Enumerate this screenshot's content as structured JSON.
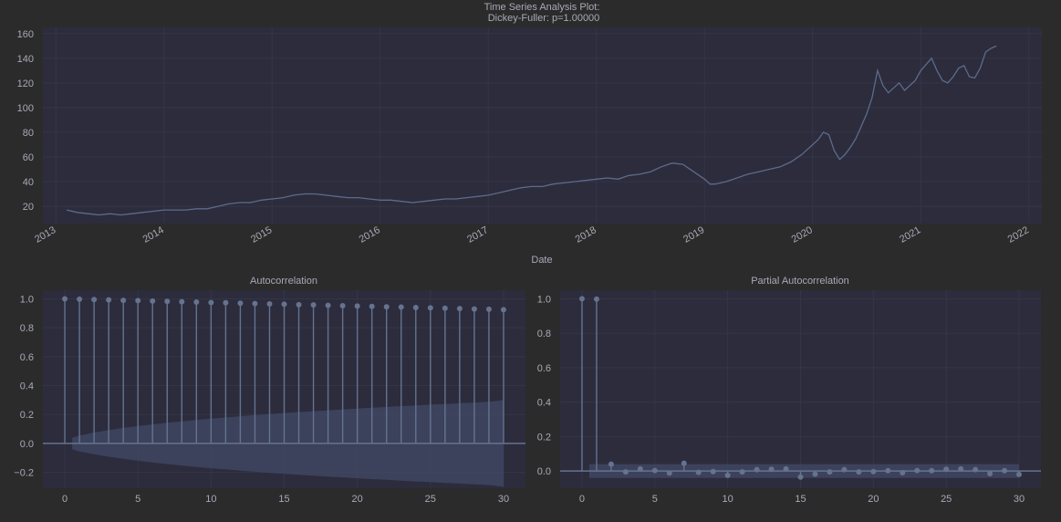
{
  "figure": {
    "title_line1": "Time Series Analysis Plot:",
    "title_line2": "Dickey-Fuller: p=1.00000"
  },
  "colors": {
    "figure_bg": "#2b2b2b",
    "axes_bg": "#2c2c3c",
    "line": "#5d6b8a",
    "stem": "#65738f",
    "conf_band": "#3f4762",
    "text": "#a9a9b8"
  },
  "chart_data": [
    {
      "type": "line",
      "title": "Time Series Analysis Plot:\nDickey-Fuller: p=1.00000",
      "xlabel": "Date",
      "ylabel": "",
      "x_ticks": [
        "2013",
        "2014",
        "2015",
        "2016",
        "2017",
        "2018",
        "2019",
        "2020",
        "2021",
        "2022"
      ],
      "y_ticks": [
        20,
        40,
        60,
        80,
        100,
        120,
        140,
        160
      ],
      "xlim": [
        2012.88,
        2022.12
      ],
      "ylim": [
        6,
        165
      ],
      "grid": true,
      "series": [
        {
          "x": [
            2013.1,
            2013.2,
            2013.3,
            2013.4,
            2013.5,
            2013.6,
            2013.7,
            2013.8,
            2013.9,
            2014.0,
            2014.1,
            2014.2,
            2014.3,
            2014.4,
            2014.5,
            2014.6,
            2014.7,
            2014.8,
            2014.9,
            2015.0,
            2015.1,
            2015.2,
            2015.3,
            2015.4,
            2015.5,
            2015.6,
            2015.7,
            2015.8,
            2015.9,
            2016.0,
            2016.1,
            2016.2,
            2016.3,
            2016.4,
            2016.5,
            2016.6,
            2016.7,
            2016.8,
            2016.9,
            2017.0,
            2017.1,
            2017.2,
            2017.3,
            2017.4,
            2017.5,
            2017.6,
            2017.7,
            2017.8,
            2017.9,
            2018.0,
            2018.1,
            2018.2,
            2018.3,
            2018.4,
            2018.5,
            2018.6,
            2018.7,
            2018.8,
            2018.9,
            2019.0,
            2019.05,
            2019.1,
            2019.2,
            2019.3,
            2019.4,
            2019.5,
            2019.6,
            2019.7,
            2019.8,
            2019.9,
            2020.0,
            2020.05,
            2020.1,
            2020.15,
            2020.2,
            2020.25,
            2020.3,
            2020.35,
            2020.4,
            2020.45,
            2020.5,
            2020.55,
            2020.6,
            2020.65,
            2020.7,
            2020.75,
            2020.8,
            2020.85,
            2020.9,
            2020.95,
            2021.0,
            2021.05,
            2021.1,
            2021.15,
            2021.2,
            2021.25,
            2021.3,
            2021.35,
            2021.4,
            2021.45,
            2021.5,
            2021.55,
            2021.6,
            2021.65,
            2021.7
          ],
          "y": [
            17,
            15,
            14,
            13,
            14,
            13,
            14,
            15,
            16,
            17,
            17,
            17,
            18,
            18,
            20,
            22,
            23,
            23,
            25,
            26,
            27,
            29,
            30,
            30,
            29,
            28,
            27,
            27,
            26,
            25,
            25,
            24,
            23,
            24,
            25,
            26,
            26,
            27,
            28,
            29,
            31,
            33,
            35,
            36,
            36,
            38,
            39,
            40,
            41,
            42,
            43,
            42,
            45,
            46,
            48,
            52,
            55,
            54,
            48,
            42,
            38,
            38,
            40,
            43,
            46,
            48,
            50,
            52,
            56,
            62,
            70,
            74,
            80,
            78,
            65,
            58,
            62,
            68,
            75,
            85,
            95,
            108,
            130,
            118,
            112,
            116,
            120,
            114,
            118,
            122,
            130,
            135,
            140,
            130,
            122,
            120,
            125,
            132,
            134,
            125,
            124,
            132,
            145,
            148,
            150
          ]
        }
      ]
    },
    {
      "type": "stem",
      "title": "Autocorrelation",
      "x": [
        0,
        1,
        2,
        3,
        4,
        5,
        6,
        7,
        8,
        9,
        10,
        11,
        12,
        13,
        14,
        15,
        16,
        17,
        18,
        19,
        20,
        21,
        22,
        23,
        24,
        25,
        26,
        27,
        28,
        29,
        30
      ],
      "values": [
        1.0,
        0.998,
        0.995,
        0.993,
        0.99,
        0.988,
        0.985,
        0.983,
        0.98,
        0.978,
        0.975,
        0.973,
        0.97,
        0.968,
        0.965,
        0.963,
        0.96,
        0.958,
        0.955,
        0.953,
        0.95,
        0.948,
        0.945,
        0.943,
        0.94,
        0.938,
        0.935,
        0.933,
        0.93,
        0.928,
        0.925
      ],
      "conf_band_upper": [
        0.04,
        0.055,
        0.075,
        0.092,
        0.107,
        0.12,
        0.132,
        0.143,
        0.153,
        0.163,
        0.172,
        0.18,
        0.188,
        0.196,
        0.203,
        0.21,
        0.217,
        0.223,
        0.229,
        0.235,
        0.241,
        0.247,
        0.252,
        0.258,
        0.263,
        0.268,
        0.273,
        0.278,
        0.283,
        0.288,
        0.3
      ],
      "x_ticks": [
        0,
        5,
        10,
        15,
        20,
        25,
        30
      ],
      "y_ticks": [
        "1.0",
        "0.8",
        "0.6",
        "0.4",
        "0.2",
        "0.0",
        "−0.2"
      ],
      "xlim": [
        -1.5,
        31.5
      ],
      "ylim": [
        -0.31,
        1.06
      ],
      "grid": true
    },
    {
      "type": "stem",
      "title": "Partial Autocorrelation",
      "x": [
        0,
        1,
        2,
        3,
        4,
        5,
        6,
        7,
        8,
        9,
        10,
        11,
        12,
        13,
        14,
        15,
        16,
        17,
        18,
        19,
        20,
        21,
        22,
        23,
        24,
        25,
        26,
        27,
        28,
        29,
        30
      ],
      "values": [
        1.0,
        0.998,
        0.04,
        -0.005,
        0.012,
        0.003,
        -0.012,
        0.045,
        -0.008,
        -0.003,
        -0.025,
        -0.005,
        0.008,
        0.01,
        0.012,
        -0.035,
        -0.018,
        -0.005,
        0.008,
        -0.005,
        -0.003,
        0.002,
        -0.01,
        0.003,
        0.002,
        0.01,
        0.012,
        0.008,
        -0.015,
        0.002,
        -0.02
      ],
      "conf_band_upper": [
        0.04,
        0.04,
        0.04,
        0.04,
        0.04,
        0.04,
        0.04,
        0.04,
        0.04,
        0.04,
        0.04,
        0.04,
        0.04,
        0.04,
        0.04,
        0.04,
        0.04,
        0.04,
        0.04,
        0.04,
        0.04,
        0.04,
        0.04,
        0.04,
        0.04,
        0.04,
        0.04,
        0.04,
        0.04,
        0.04,
        0.04
      ],
      "x_ticks": [
        0,
        5,
        10,
        15,
        20,
        25,
        30
      ],
      "y_ticks": [
        "1.0",
        "0.8",
        "0.6",
        "0.4",
        "0.2",
        "0.0"
      ],
      "xlim": [
        -1.5,
        31.5
      ],
      "ylim": [
        -0.1,
        1.05
      ],
      "grid": true
    }
  ]
}
